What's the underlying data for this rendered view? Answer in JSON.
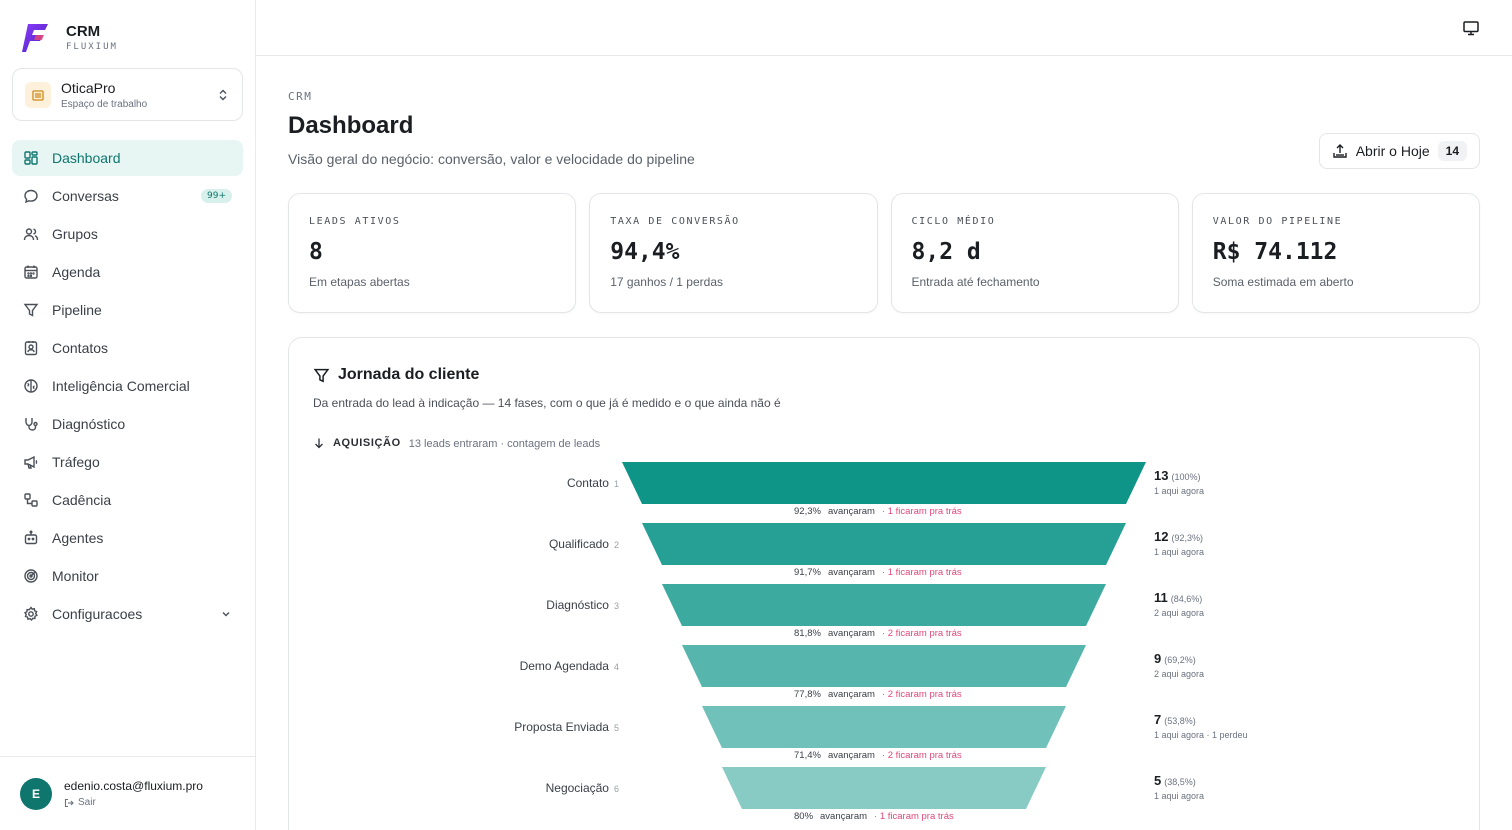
{
  "brand": {
    "title": "CRM",
    "subtitle": "FLUXIUM"
  },
  "workspace": {
    "name": "OticaPro",
    "subtitle": "Espaço de trabalho"
  },
  "nav": [
    {
      "label": "Dashboard",
      "icon": "dashboard-icon",
      "active": true
    },
    {
      "label": "Conversas",
      "icon": "chat-icon",
      "badge": "99+"
    },
    {
      "label": "Grupos",
      "icon": "users-icon"
    },
    {
      "label": "Agenda",
      "icon": "calendar-icon"
    },
    {
      "label": "Pipeline",
      "icon": "filter-icon"
    },
    {
      "label": "Contatos",
      "icon": "contacts-icon"
    },
    {
      "label": "Inteligência Comercial",
      "icon": "brain-icon"
    },
    {
      "label": "Diagnóstico",
      "icon": "stethoscope-icon"
    },
    {
      "label": "Tráfego",
      "icon": "megaphone-icon"
    },
    {
      "label": "Cadência",
      "icon": "workflow-icon"
    },
    {
      "label": "Agentes",
      "icon": "bot-icon"
    },
    {
      "label": "Monitor",
      "icon": "radar-icon"
    },
    {
      "label": "Configuracoes",
      "icon": "gear-icon",
      "expandable": true
    }
  ],
  "user": {
    "initial": "E",
    "email": "edenio.costa@fluxium.pro",
    "logout": "Sair"
  },
  "header": {
    "eyebrow": "CRM",
    "title": "Dashboard",
    "subtitle": "Visão geral do negócio: conversão, valor e velocidade do pipeline",
    "today_button": "Abrir o Hoje",
    "today_count": "14"
  },
  "kpis": [
    {
      "label": "LEADS ATIVOS",
      "value": "8",
      "hint": "Em etapas abertas"
    },
    {
      "label": "TAXA DE CONVERSÃO",
      "value": "94,4%",
      "hint": "17 ganhos / 1 perdas"
    },
    {
      "label": "CICLO MÉDIO",
      "value": "8,2 d",
      "hint": "Entrada até fechamento"
    },
    {
      "label": "VALOR DO PIPELINE",
      "value": "R$ 74.112",
      "hint": "Soma estimada em aberto"
    }
  ],
  "journey": {
    "title": "Jornada do cliente",
    "subtitle": "Da entrada do lead à indicação — 14 fases, com o que já é medido e o que ainda não é",
    "phase": {
      "name": "AQUISIÇÃO",
      "note": "13 leads entraram · contagem de leads"
    },
    "advanced_label": "avançaram",
    "stages": [
      {
        "name": "Contato",
        "index": "1",
        "count": "13",
        "pct": "(100%)",
        "now": "1 aqui agora",
        "conv": "92,3%",
        "lost": "· 1 ficaram pra trás",
        "color": "#0f9488",
        "value": 13
      },
      {
        "name": "Qualificado",
        "index": "2",
        "count": "12",
        "pct": "(92,3%)",
        "now": "1 aqui agora",
        "conv": "91,7%",
        "lost": "· 1 ficaram pra trás",
        "color": "#26a095",
        "value": 12
      },
      {
        "name": "Diagnóstico",
        "index": "3",
        "count": "11",
        "pct": "(84,6%)",
        "now": "2 aqui agora",
        "conv": "81,8%",
        "lost": "· 2 ficaram pra trás",
        "color": "#3daaa0",
        "value": 11
      },
      {
        "name": "Demo Agendada",
        "index": "4",
        "count": "9",
        "pct": "(69,2%)",
        "now": "2 aqui agora",
        "conv": "77,8%",
        "lost": "· 2 ficaram pra trás",
        "color": "#56b5ac",
        "value": 9
      },
      {
        "name": "Proposta Enviada",
        "index": "5",
        "count": "7",
        "pct": "(53,8%)",
        "now": "1 aqui agora · 1 perdeu",
        "conv": "71,4%",
        "lost": "· 2 ficaram pra trás",
        "color": "#70c1b9",
        "value": 7
      },
      {
        "name": "Negociação",
        "index": "6",
        "count": "5",
        "pct": "(38,5%)",
        "now": "1 aqui agora",
        "conv": "80%",
        "lost": "· 1 ficaram pra trás",
        "color": "#88cbc4",
        "value": 5
      }
    ]
  }
}
